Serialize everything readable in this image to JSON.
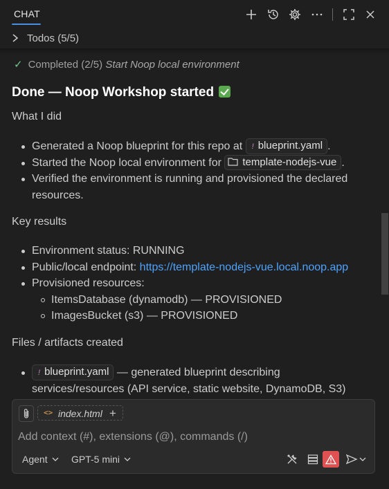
{
  "header": {
    "tab_label": "CHAT",
    "icons": [
      "plus-icon",
      "history-icon",
      "gear-icon",
      "more-icon",
      "maximize-icon",
      "close-icon"
    ]
  },
  "todos": {
    "label": "Todos (5/5)"
  },
  "content": {
    "completed": {
      "label": "Completed (2/5)",
      "task": "Start Noop local environment"
    },
    "title": "Done — Noop Workshop started",
    "what_i_did": {
      "heading": "What I did",
      "item1_before": "Generated a Noop blueprint for this repo at",
      "item1_code": "blueprint.yaml",
      "item1_after": ".",
      "item2_before": "Started the Noop local environment for",
      "item2_code": "template-nodejs-vue",
      "item2_after": ".",
      "item3": "Verified the environment is running and provisioned the declared resources."
    },
    "key_results": {
      "heading": "Key results",
      "status": "Environment status: RUNNING",
      "endpoint_label": "Public/local endpoint:",
      "endpoint_url": "https://template-nodejs-vue.local.noop.app",
      "resources_label": "Provisioned resources:",
      "resource1": "ItemsDatabase (dynamodb) — PROVISIONED",
      "resource2": "ImagesBucket (s3) — PROVISIONED"
    },
    "files": {
      "heading": "Files / artifacts created",
      "item1_code": "blueprint.yaml",
      "item1_text": "— generated blueprint describing",
      "item1_cont": "services/resources (API service, static website, DynamoDB, S3)"
    }
  },
  "input": {
    "file_chip": "index.html",
    "placeholder": "Add context (#), extensions (@), commands (/)",
    "mode": "Agent",
    "model": "GPT-5 mini"
  },
  "colors": {
    "background": "#1f1f1f",
    "link": "#4da3ff",
    "accent": "#4a90e2",
    "warning": "#e05252",
    "success": "#73c991"
  }
}
